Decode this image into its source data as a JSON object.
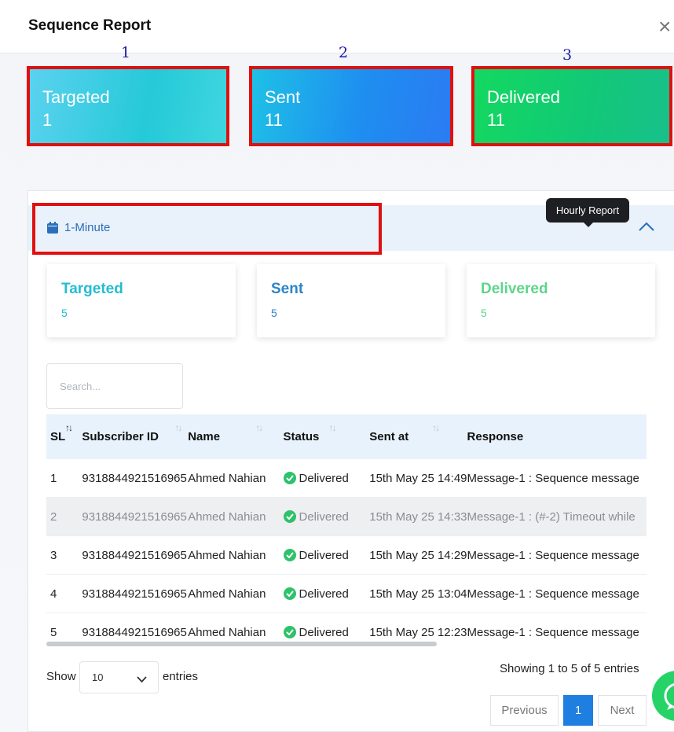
{
  "modal": {
    "title": "Sequence Report",
    "close_label": "×"
  },
  "annotations": [
    "1",
    "2",
    "3"
  ],
  "summary_cards": [
    {
      "label": "Targeted",
      "value": "1"
    },
    {
      "label": "Sent",
      "value": "11"
    },
    {
      "label": "Delivered",
      "value": "11"
    }
  ],
  "accordion": {
    "title": "1-Minute",
    "tooltip": "Hourly Report"
  },
  "mini_cards": [
    {
      "label": "Targeted",
      "value": "5"
    },
    {
      "label": "Sent",
      "value": "5"
    },
    {
      "label": "Delivered",
      "value": "5"
    }
  ],
  "search": {
    "placeholder": "Search..."
  },
  "table": {
    "columns": [
      "SL",
      "Subscriber ID",
      "Name",
      "Status",
      "Sent at",
      "Response"
    ],
    "rows": [
      [
        "1",
        "9318844921516965",
        "Ahmed Nahian",
        "Delivered",
        "15th May 25 14:49",
        "Message-1 : Sequence message"
      ],
      [
        "2",
        "9318844921516965",
        "Ahmed Nahian",
        "Delivered",
        "15th May 25 14:33",
        "Message-1 : (#-2) Timeout while"
      ],
      [
        "3",
        "9318844921516965",
        "Ahmed Nahian",
        "Delivered",
        "15th May 25 14:29",
        "Message-1 : Sequence message"
      ],
      [
        "4",
        "9318844921516965",
        "Ahmed Nahian",
        "Delivered",
        "15th May 25 13:04",
        "Message-1 : Sequence message"
      ],
      [
        "5",
        "9318844921516965",
        "Ahmed Nahian",
        "Delivered",
        "15th May 25 12:23",
        "Message-1 : Sequence message"
      ]
    ]
  },
  "footer": {
    "show_label": "Show",
    "page_length": "10",
    "entries_label": "entries",
    "info": "Showing 1 to 5 of 5 entries",
    "prev_label": "Previous",
    "page_1": "1",
    "next_label": "Next"
  },
  "colors": {
    "annotation_box": "#e01010",
    "targeted": "#25bcd0",
    "sent": "#2c84c8",
    "delivered": "#5fd48b",
    "primary": "#1e7fe0"
  }
}
